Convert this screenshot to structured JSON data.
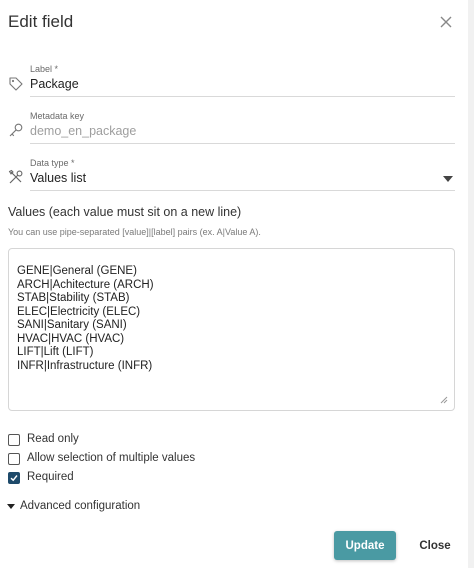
{
  "dialog": {
    "title": "Edit field"
  },
  "fields": {
    "label": {
      "label": "Label *",
      "value": "Package"
    },
    "metadata_key": {
      "label": "Metadata key",
      "value": "demo_en_package"
    },
    "data_type": {
      "label": "Data type *",
      "value": "Values list"
    }
  },
  "values": {
    "title": "Values (each value must sit on a new line)",
    "hint": "You can use pipe-separated [value]|[label] pairs (ex. A|Value A).",
    "content": "GENE|General (GENE)\nARCH|Achitecture (ARCH)\nSTAB|Stability (STAB)\nELEC|Electricity (ELEC)\nSANI|Sanitary (SANI)\nHVAC|HVAC (HVAC)\nLIFT|Lift (LIFT)\nINFR|Infrastructure (INFR)"
  },
  "options": {
    "read_only": {
      "label": "Read only",
      "checked": false
    },
    "multiple": {
      "label": "Allow selection of multiple values",
      "checked": false
    },
    "required": {
      "label": "Required",
      "checked": true
    }
  },
  "advanced": {
    "label": "Advanced configuration"
  },
  "actions": {
    "update": "Update",
    "close": "Close"
  },
  "colors": {
    "accent": "#4a9aa3",
    "checkbox_checked": "#1e4a6a"
  },
  "icons": {
    "label": "tag-icon",
    "metadata_key": "key-icon",
    "data_type": "tools-icon"
  }
}
